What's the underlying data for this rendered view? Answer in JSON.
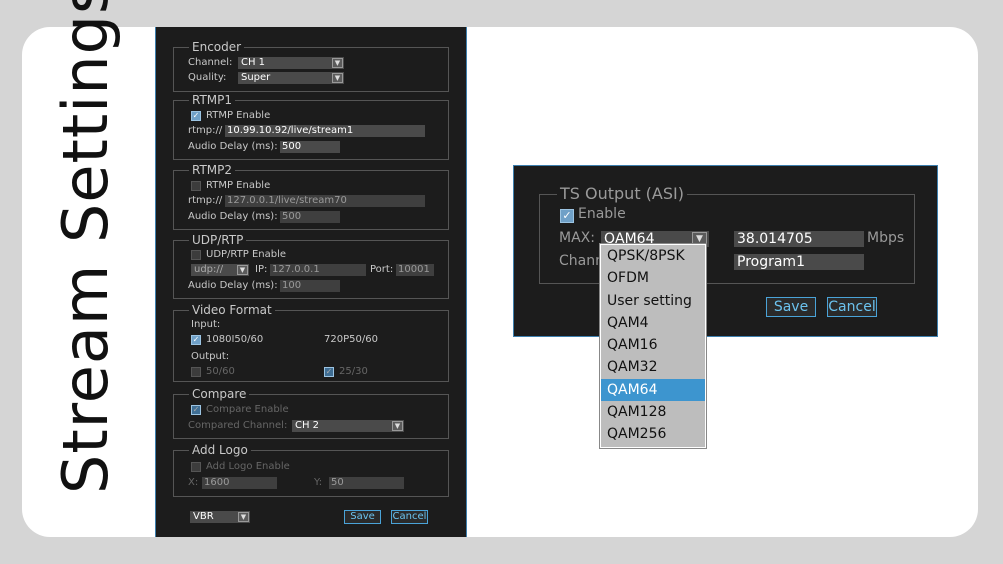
{
  "side_title": "Stream Settings",
  "left_panel": {
    "encoder": {
      "legend": "Encoder",
      "channel_label": "Channel:",
      "channel_value": "CH 1",
      "quality_label": "Quality:",
      "quality_value": "Super"
    },
    "rtmp1": {
      "legend": "RTMP1",
      "enable_label": "RTMP Enable",
      "enabled": true,
      "url_label": "rtmp://",
      "url_value": "10.99.10.92/live/stream1",
      "delay_label": "Audio Delay (ms):",
      "delay_value": "500"
    },
    "rtmp2": {
      "legend": "RTMP2",
      "enable_label": "RTMP Enable",
      "enabled": false,
      "url_label": "rtmp://",
      "url_value": "127.0.0.1/live/stream70",
      "delay_label": "Audio Delay (ms):",
      "delay_value": "500"
    },
    "udp": {
      "legend": "UDP/RTP",
      "enable_label": "UDP/RTP Enable",
      "enabled": false,
      "proto_value": "udp://",
      "ip_label": "IP:",
      "ip_value": "127.0.0.1",
      "port_label": "Port:",
      "port_value": "10001",
      "delay_label": "Audio Delay (ms):",
      "delay_value": "100"
    },
    "video": {
      "legend": "Video Format",
      "input_label": "Input:",
      "in1_label": "1080I50/60",
      "in1_checked": true,
      "in2_label": "720P50/60",
      "output_label": "Output:",
      "out1_label": "50/60",
      "out1_checked": false,
      "out2_label": "25/30",
      "out2_checked": true
    },
    "compare": {
      "legend": "Compare",
      "enable_label": "Compare Enable",
      "enabled": true,
      "channel_label": "Compared Channel:",
      "channel_value": "CH 2"
    },
    "logo": {
      "legend": "Add Logo",
      "enable_label": "Add Logo Enable",
      "enabled": false,
      "x_label": "X:",
      "x_value": "1600",
      "y_label": "Y:",
      "y_value": "50"
    },
    "mode_value": "VBR",
    "save_label": "Save",
    "cancel_label": "Cancel"
  },
  "ts_output": {
    "legend": "TS Output (ASI)",
    "enable_label": "Enable",
    "enabled": true,
    "max_label": "MAX:",
    "max_value": "QAM64",
    "rate_value": "38.014705",
    "rate_unit": "Mbps",
    "channel_label": "Chann",
    "program_value": "Program1",
    "save_label": "Save",
    "cancel_label": "Cancel",
    "dropdown_options": [
      "QPSK/8PSK",
      "OFDM",
      "User setting",
      "QAM4",
      "QAM16",
      "QAM32",
      "QAM64",
      "QAM128",
      "QAM256"
    ],
    "selected_option": "QAM64"
  },
  "colors": {
    "panel_bg": "#1c1c1c",
    "accent": "#4aa3d8",
    "selected": "#3d95cf"
  }
}
